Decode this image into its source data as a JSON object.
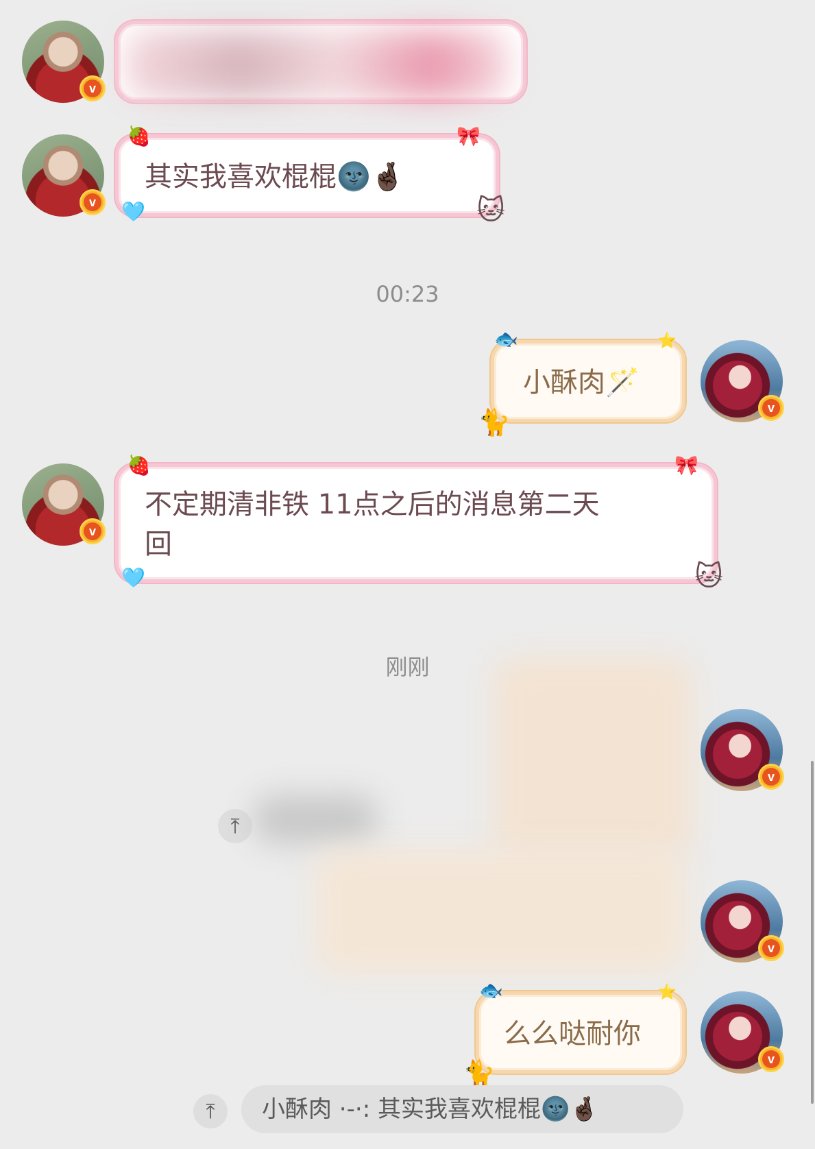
{
  "messages": [
    {
      "id": "m2",
      "side": "left",
      "text": "其实我喜欢棍棍",
      "emoji": "🌚🤞🏿"
    },
    {
      "id": "m3",
      "side": "right",
      "text": "小酥肉",
      "emoji": "🪄"
    },
    {
      "id": "m4",
      "side": "left",
      "line1": "不定期清非铁 11点之后的消息第二天",
      "line2": "回"
    },
    {
      "id": "m6",
      "side": "right",
      "text": "么么哒耐你"
    }
  ],
  "timestamps": {
    "t1": "00:23",
    "t2": "刚刚"
  },
  "quote": {
    "text": "小酥肉 ·-·: 其实我喜欢棍棍🌚🤞🏿"
  },
  "icons": {
    "verified": "v",
    "pin": "⤒"
  }
}
